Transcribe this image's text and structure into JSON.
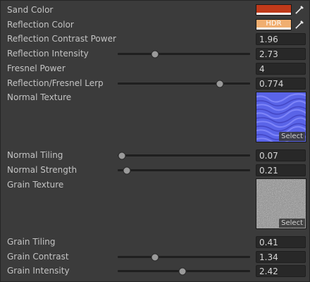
{
  "colors": {
    "sand_color": "#c03a1a",
    "reflection_color": "#f0ae70",
    "normal_tex_base": "#5a64e8",
    "grain_tex_base": "#8a8a8a"
  },
  "properties": {
    "sand_color": {
      "label": "Sand Color",
      "picker_icon": "eyedropper-icon"
    },
    "reflection_color": {
      "label": "Reflection Color",
      "badge": "HDR",
      "picker_icon": "eyedropper-icon"
    },
    "reflection_contrast_power": {
      "label": "Reflection Contrast Power",
      "value": "1.96"
    },
    "reflection_intensity": {
      "label": "Reflection Intensity",
      "value": "2.73",
      "slider_fraction": 0.28
    },
    "fresnel_power": {
      "label": "Fresnel Power",
      "value": "4"
    },
    "reflection_fresnel_lerp": {
      "label": "Reflection/Fresnel Lerp",
      "value": "0.774",
      "slider_fraction": 0.77
    },
    "normal_texture": {
      "label": "Normal Texture",
      "select_label": "Select"
    },
    "normal_tiling": {
      "label": "Normal Tiling",
      "value": "0.07",
      "slider_fraction": 0.03
    },
    "normal_strength": {
      "label": "Normal Strength",
      "value": "0.21",
      "slider_fraction": 0.07
    },
    "grain_texture": {
      "label": "Grain Texture",
      "select_label": "Select"
    },
    "grain_tiling": {
      "label": "Grain Tiling",
      "value": "0.41"
    },
    "grain_contrast": {
      "label": "Grain Contrast",
      "value": "1.34",
      "slider_fraction": 0.28
    },
    "grain_intensity": {
      "label": "Grain Intensity",
      "value": "2.42",
      "slider_fraction": 0.49
    }
  }
}
